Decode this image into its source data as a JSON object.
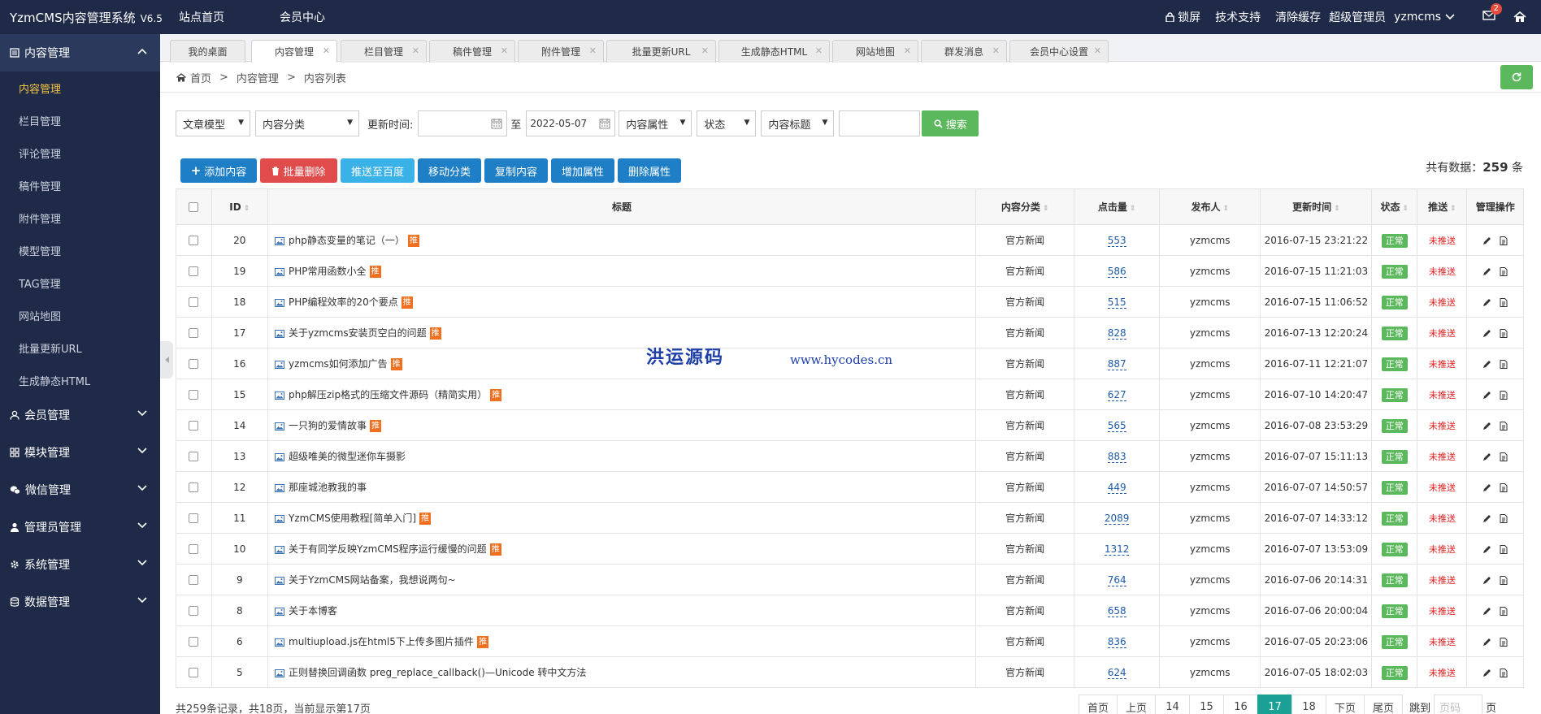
{
  "topbar": {
    "brand": "YzmCMS内容管理系统",
    "version": "V6.5",
    "nav": [
      "站点首页",
      "会员中心"
    ],
    "lock": "锁屏",
    "support": "技术支持",
    "clear_cache": "清除缓存",
    "role": "超级管理员",
    "user": "yzmcms",
    "mail_count": "2"
  },
  "sidebar": {
    "groups": [
      {
        "label": "内容管理",
        "icon": "document-icon"
      },
      {
        "label": "会员管理",
        "icon": "user-icon"
      },
      {
        "label": "模块管理",
        "icon": "grid-icon"
      },
      {
        "label": "微信管理",
        "icon": "wechat-icon"
      },
      {
        "label": "管理员管理",
        "icon": "admin-icon"
      },
      {
        "label": "系统管理",
        "icon": "gear-icon"
      },
      {
        "label": "数据管理",
        "icon": "database-icon"
      }
    ],
    "items": [
      "内容管理",
      "栏目管理",
      "评论管理",
      "稿件管理",
      "附件管理",
      "模型管理",
      "TAG管理",
      "网站地图",
      "批量更新URL",
      "生成静态HTML"
    ]
  },
  "tabs": [
    "我的桌面",
    "内容管理",
    "栏目管理",
    "稿件管理",
    "附件管理",
    "批量更新URL",
    "生成静态HTML",
    "网站地图",
    "群发消息",
    "会员中心设置"
  ],
  "breadcrumb": [
    "首页",
    "内容管理",
    "内容列表"
  ],
  "filters": {
    "model": "文章模型",
    "category": "内容分类",
    "update_time_label": "更新时间:",
    "to_label": "至",
    "date_end": "2022-05-07",
    "attr": "内容属性",
    "status": "状态",
    "field": "内容标题",
    "search": "搜索"
  },
  "actions": {
    "add": "添加内容",
    "batch_delete": "批量删除",
    "push_baidu": "推送至百度",
    "move": "移动分类",
    "copy": "复制内容",
    "add_attr": "增加属性",
    "del_attr": "删除属性"
  },
  "total": {
    "label": "共有数据：",
    "count": "259",
    "unit": "条"
  },
  "table": {
    "headers": [
      "ID",
      "标题",
      "内容分类",
      "点击量",
      "发布人",
      "更新时间",
      "状态",
      "推送",
      "管理操作"
    ],
    "rows": [
      {
        "id": "20",
        "title": "php静态变量的笔记（一）",
        "tui": "推",
        "cat": "官方新闻",
        "hits": "553",
        "author": "yzmcms",
        "time": "2016-07-15 23:21:22",
        "status": "正常",
        "push": "未推送"
      },
      {
        "id": "19",
        "title": "PHP常用函数小全",
        "tui": "推",
        "cat": "官方新闻",
        "hits": "586",
        "author": "yzmcms",
        "time": "2016-07-15 11:21:03",
        "status": "正常",
        "push": "未推送"
      },
      {
        "id": "18",
        "title": "PHP编程效率的20个要点",
        "tui": "推",
        "cat": "官方新闻",
        "hits": "515",
        "author": "yzmcms",
        "time": "2016-07-15 11:06:52",
        "status": "正常",
        "push": "未推送"
      },
      {
        "id": "17",
        "title": "关于yzmcms安装页空白的问题",
        "tui": "推",
        "cat": "官方新闻",
        "hits": "828",
        "author": "yzmcms",
        "time": "2016-07-13 12:20:24",
        "status": "正常",
        "push": "未推送"
      },
      {
        "id": "16",
        "title": "yzmcms如何添加广告",
        "tui": "推",
        "cat": "官方新闻",
        "hits": "887",
        "author": "yzmcms",
        "time": "2016-07-11 12:21:07",
        "status": "正常",
        "push": "未推送"
      },
      {
        "id": "15",
        "title": "php解压zip格式的压缩文件源码（精简实用）",
        "tui": "推",
        "cat": "官方新闻",
        "hits": "627",
        "author": "yzmcms",
        "time": "2016-07-10 14:20:47",
        "status": "正常",
        "push": "未推送"
      },
      {
        "id": "14",
        "title": "一只狗的爱情故事",
        "tui": "推",
        "cat": "官方新闻",
        "hits": "565",
        "author": "yzmcms",
        "time": "2016-07-08 23:53:29",
        "status": "正常",
        "push": "未推送"
      },
      {
        "id": "13",
        "title": "超级唯美的微型迷你车摄影",
        "tui": "",
        "cat": "官方新闻",
        "hits": "883",
        "author": "yzmcms",
        "time": "2016-07-07 15:11:13",
        "status": "正常",
        "push": "未推送"
      },
      {
        "id": "12",
        "title": "那座城池教我的事",
        "tui": "",
        "cat": "官方新闻",
        "hits": "449",
        "author": "yzmcms",
        "time": "2016-07-07 14:50:57",
        "status": "正常",
        "push": "未推送"
      },
      {
        "id": "11",
        "title": "YzmCMS使用教程[简单入门]",
        "tui": "推",
        "cat": "官方新闻",
        "hits": "2089",
        "author": "yzmcms",
        "time": "2016-07-07 14:33:12",
        "status": "正常",
        "push": "未推送"
      },
      {
        "id": "10",
        "title": "关于有同学反映YzmCMS程序运行缓慢的问题",
        "tui": "推",
        "cat": "官方新闻",
        "hits": "1312",
        "author": "yzmcms",
        "time": "2016-07-07 13:53:09",
        "status": "正常",
        "push": "未推送"
      },
      {
        "id": "9",
        "title": "关于YzmCMS网站备案，我想说两句~",
        "tui": "",
        "cat": "官方新闻",
        "hits": "764",
        "author": "yzmcms",
        "time": "2016-07-06 20:14:31",
        "status": "正常",
        "push": "未推送"
      },
      {
        "id": "8",
        "title": "关于本博客",
        "tui": "",
        "cat": "官方新闻",
        "hits": "658",
        "author": "yzmcms",
        "time": "2016-07-06 20:00:04",
        "status": "正常",
        "push": "未推送"
      },
      {
        "id": "6",
        "title": "multiupload.js在html5下上传多图片插件",
        "tui": "推",
        "cat": "官方新闻",
        "hits": "836",
        "author": "yzmcms",
        "time": "2016-07-05 20:23:06",
        "status": "正常",
        "push": "未推送"
      },
      {
        "id": "5",
        "title": "正则替换回调函数 preg_replace_callback()—Unicode 转中文方法",
        "tui": "",
        "cat": "官方新闻",
        "hits": "624",
        "author": "yzmcms",
        "time": "2016-07-05 18:02:03",
        "status": "正常",
        "push": "未推送"
      }
    ]
  },
  "footer": {
    "summary": "共259条记录，共18页，当前显示第17页"
  },
  "pager": {
    "items": [
      "首页",
      "上页",
      "14",
      "15",
      "16",
      "17",
      "18",
      "下页",
      "尾页"
    ],
    "current": "17",
    "goto_label": "跳到",
    "placeholder": "页码",
    "page_label": "页"
  },
  "watermark": {
    "cn": "洪运源码",
    "url": "www.hycodes.cn"
  },
  "colors": {
    "nav_bg": "#1e2a47",
    "green": "#5cb85c",
    "blue": "#1e7fc6",
    "red": "#e04b4b",
    "active_yellow": "#f5c344",
    "pager_current": "#1aa094"
  }
}
